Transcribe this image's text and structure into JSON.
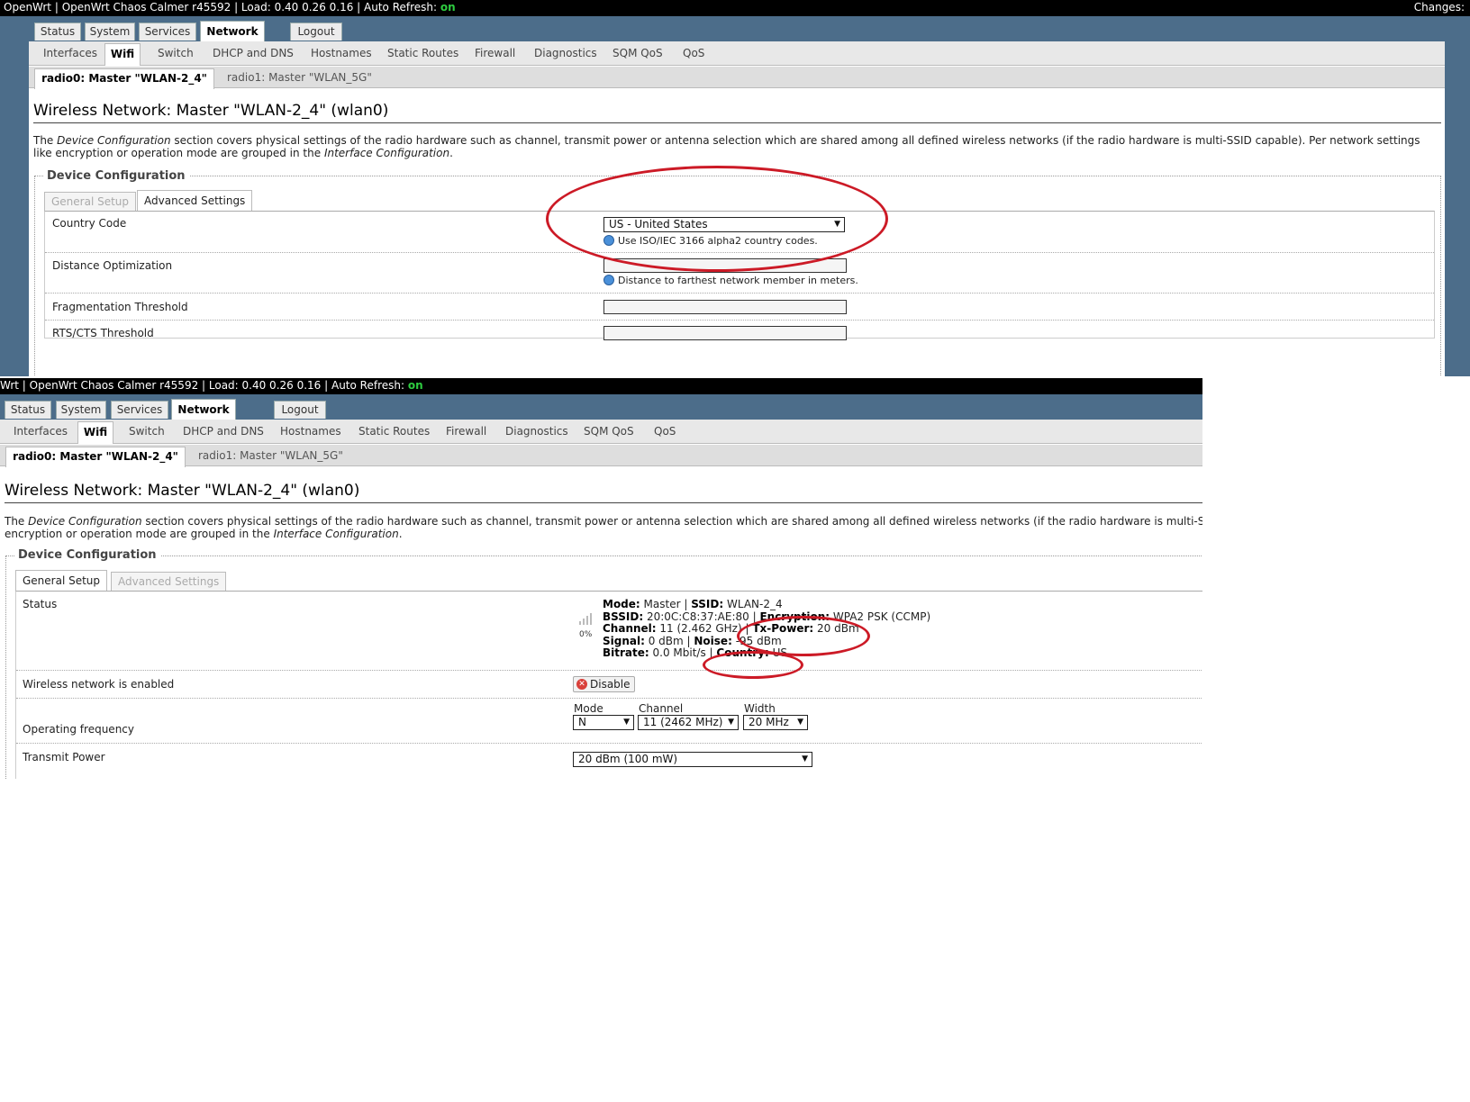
{
  "header": {
    "title_prefix": "OpenWrt | OpenWrt Chaos Calmer r45592 | Load: 0.40 0.26 0.16 | Auto Refresh: ",
    "title_prefix_cropped": "Wrt | OpenWrt Chaos Calmer r45592 | Load: 0.40 0.26 0.16 | Auto Refresh: ",
    "auto_refresh": "on",
    "changes": "Changes:"
  },
  "main_tabs": [
    "Status",
    "System",
    "Services",
    "Network",
    "Logout"
  ],
  "sub_tabs": [
    "Interfaces",
    "Wifi",
    "Switch",
    "DHCP and DNS",
    "Hostnames",
    "Static Routes",
    "Firewall",
    "Diagnostics",
    "SQM QoS",
    "QoS"
  ],
  "radio_tabs": [
    "radio0: Master \"WLAN-2_4\"",
    "radio1: Master \"WLAN_5G\""
  ],
  "page": {
    "heading": "Wireless Network: Master \"WLAN-2_4\" (wlan0)",
    "desc_1": "The ",
    "desc_em1": "Device Configuration",
    "desc_2": " section covers physical settings of the radio hardware such as channel, transmit power or antenna selection which are shared among all defined wireless networks (if the radio hardware is multi-SSID capable). Per network settings like encryption or operation mode are grouped in the ",
    "desc_em2": "Interface Configuration",
    "desc_3": ".",
    "desc_2_cropped_line1": " section covers physical settings of the radio hardware such as channel, transmit power or antenna selection which are shared among all defined wireless networks (if the radio hardware is multi-SSID cap",
    "desc_2_cropped_line2": "encryption or operation mode are grouped in the ",
    "legend": "Device Configuration",
    "config_tabs": [
      "General Setup",
      "Advanced Settings"
    ]
  },
  "advanced": {
    "country_label": "Country Code",
    "country_value": "US - United States",
    "country_help": "Use ISO/IEC 3166 alpha2 country codes.",
    "distance_label": "Distance Optimization",
    "distance_value": "",
    "distance_help": "Distance to farthest network member in meters.",
    "frag_label": "Fragmentation Threshold",
    "frag_value": "",
    "rts_label": "RTS/CTS Threshold",
    "rts_value": ""
  },
  "general": {
    "status_label": "Status",
    "signal_percent": "0%",
    "mode_label": "Mode:",
    "mode_value": " Master | ",
    "ssid_label": "SSID:",
    "ssid_value": " WLAN-2_4",
    "bssid_label": "BSSID:",
    "bssid_value": " 20:0C:C8:37:AE:80 | ",
    "encryption_label": "Encryption:",
    "encryption_value": " WPA2 PSK (CCMP)",
    "channel_label": "Channel:",
    "channel_value": " 11 (2.462 GHz) | ",
    "txpower_label": "Tx-Power:",
    "txpower_value": " 20 dBm",
    "signal_label": "Signal:",
    "signal_value": " 0 dBm | ",
    "noise_label": "Noise:",
    "noise_value": " -95 dBm",
    "bitrate_label": "Bitrate:",
    "bitrate_value": " 0.0 Mbit/s | ",
    "country_label": "Country:",
    "country_value": " US",
    "enabled_label": "Wireless network is enabled",
    "disable_button": "Disable",
    "freq_label": "Operating frequency",
    "freq_mode_label": "Mode",
    "freq_mode_value": "N",
    "freq_channel_label": "Channel",
    "freq_channel_value": "11 (2462 MHz)",
    "freq_width_label": "Width",
    "freq_width_value": "20 MHz",
    "txpower_field_label": "Transmit Power",
    "txpower_field_value": "20 dBm (100 mW)"
  },
  "colors": {
    "top_bar": "#000000",
    "nav_band": "#4c6d8a",
    "auto_refresh_on": "#2ecc40",
    "annotation_red": "#cc1a26"
  }
}
